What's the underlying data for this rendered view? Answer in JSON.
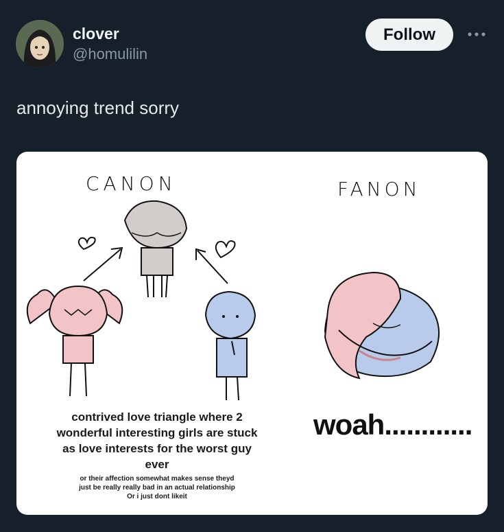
{
  "user": {
    "display_name": "clover",
    "handle": "@homulilin",
    "avatar_icon": "anime-character-avatar"
  },
  "actions": {
    "follow_label": "Follow",
    "more_icon": "more-horizontal-icon"
  },
  "tweet": {
    "text": "annoying trend sorry"
  },
  "image": {
    "left_label": "CANON",
    "right_label": "FANON",
    "left_caption_lines": [
      "contrived love triangle where 2",
      "wonderful interesting girls are stuck",
      "as love interests for the worst guy",
      "ever"
    ],
    "left_small_lines": [
      "or their affection somewhat makes sense theyd",
      "just be really really bad in an actual relationship",
      "Or i just dont likeit"
    ],
    "right_caption": "woah............",
    "colors": {
      "pink": "#f2c4c8",
      "blue": "#b9cbea",
      "gray": "#d2cdcb"
    }
  },
  "theme": {
    "background": "#15202b",
    "text": "#e7e9ea",
    "secondary_text": "#8b98a5",
    "button_bg": "#eff3f4"
  }
}
